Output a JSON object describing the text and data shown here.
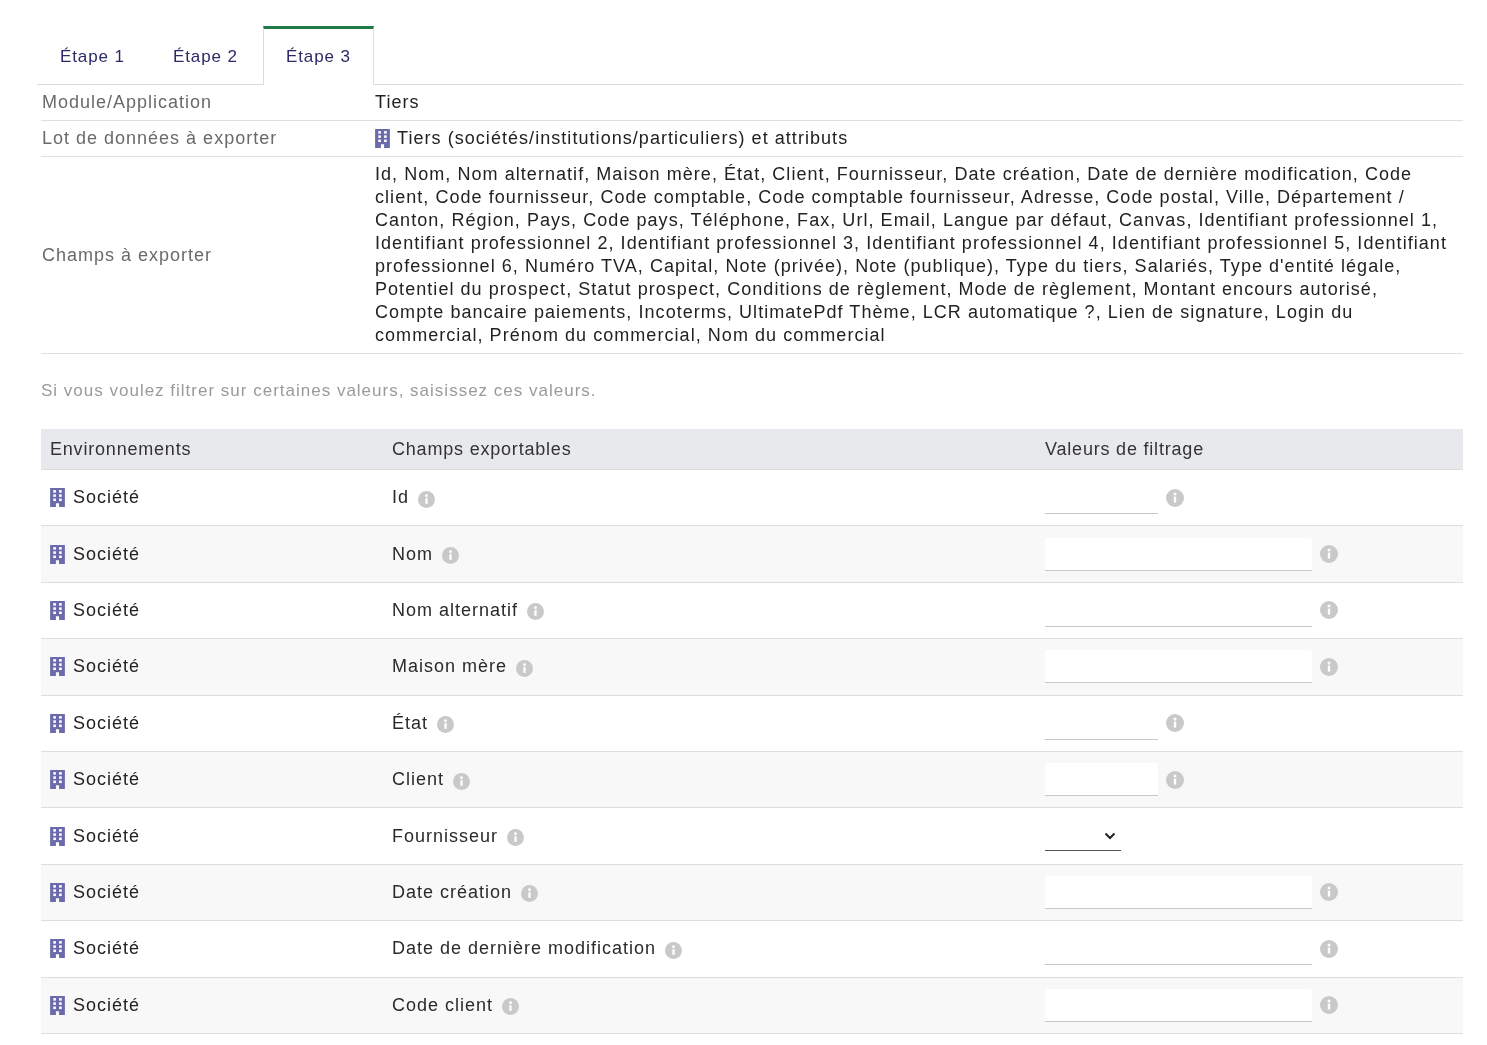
{
  "tabs": [
    {
      "label": "Étape 1",
      "selected": false
    },
    {
      "label": "Étape 2",
      "selected": false
    },
    {
      "label": "Étape 3",
      "selected": true
    }
  ],
  "summary": [
    {
      "kind": "plain",
      "label": "Module/Application",
      "value": "Tiers"
    },
    {
      "kind": "object",
      "label": "Lot de données à exporter",
      "value": "Tiers (sociétés/institutions/particuliers) et attributs"
    },
    {
      "kind": "plain",
      "label": "Champs à exporter",
      "value": "Id, Nom, Nom alternatif, Maison mère, État, Client, Fournisseur, Date création, Date de dernière modification, Code client, Code fournisseur, Code comptable, Code comptable fournisseur, Adresse, Code postal, Ville, Département / Canton, Région, Pays, Code pays, Téléphone, Fax, Url, Email, Langue par défaut, Canvas, Identifiant professionnel 1, Identifiant professionnel 2, Identifiant professionnel 3, Identifiant professionnel 4, Identifiant professionnel 5, Identifiant professionnel 6, Numéro TVA, Capital, Note (privée), Note (publique), Type du tiers, Salariés, Type d'entité légale, Potentiel du prospect, Statut prospect, Conditions de règlement, Mode de règlement, Montant encours autorisé, Compte bancaire paiements, Incoterms, UltimatePdf Thème, LCR automatique ?, Lien de signature, Login du commercial, Prénom du commercial, Nom du commercial"
    }
  ],
  "hint": "Si vous voulez filtrer sur certaines valeurs, saisissez ces valeurs.",
  "filter_table": {
    "columns": [
      "Environnements",
      "Champs exportables",
      "Valeurs de filtrage"
    ],
    "rows": [
      {
        "environment": "Société",
        "field": "Id",
        "kind": "short"
      },
      {
        "environment": "Société",
        "field": "Nom",
        "kind": "long"
      },
      {
        "environment": "Société",
        "field": "Nom alternatif",
        "kind": "long"
      },
      {
        "environment": "Société",
        "field": "Maison mère",
        "kind": "long"
      },
      {
        "environment": "Société",
        "field": "État",
        "kind": "short"
      },
      {
        "environment": "Société",
        "field": "Client",
        "kind": "short"
      },
      {
        "environment": "Société",
        "field": "Fournisseur",
        "kind": "select"
      },
      {
        "environment": "Société",
        "field": "Date création",
        "kind": "long"
      },
      {
        "environment": "Société",
        "field": "Date de dernière modification",
        "kind": "long"
      },
      {
        "environment": "Société",
        "field": "Code client",
        "kind": "long"
      }
    ]
  }
}
